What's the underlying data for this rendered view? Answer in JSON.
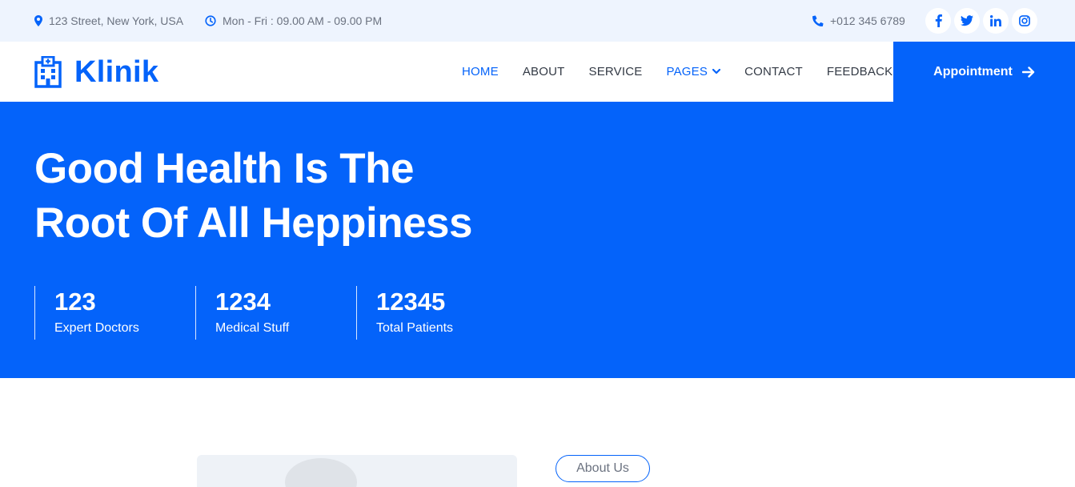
{
  "topbar": {
    "address": "123 Street, New York, USA",
    "hours": "Mon - Fri : 09.00 AM - 09.00 PM",
    "phone": "+012 345 6789",
    "icons": [
      "map-marker-icon",
      "clock-icon",
      "phone-icon"
    ],
    "socials": [
      "facebook-icon",
      "twitter-icon",
      "linkedin-icon",
      "instagram-icon"
    ]
  },
  "navbar": {
    "brand": "Klinik",
    "logo_icon": "hospital-icon",
    "links": {
      "home": "HOME",
      "about": "ABOUT",
      "service": "SERVICE",
      "pages": "PAGES",
      "contact": "CONTACT",
      "feedback": "FEEDBACK"
    },
    "active": "home",
    "appointment": "Appointment"
  },
  "hero": {
    "title_line1": "Good Health Is The",
    "title_line2": "Root Of All Heppiness",
    "stats": [
      {
        "number": "123",
        "label": "Expert Doctors"
      },
      {
        "number": "1234",
        "label": "Medical Stuff"
      },
      {
        "number": "12345",
        "label": "Total Patients"
      }
    ]
  },
  "about": {
    "pill": "About Us"
  },
  "colors": {
    "primary": "#0463fa",
    "topbar_bg": "#eef4fe",
    "text": "#333a45",
    "muted": "#6b7280"
  }
}
